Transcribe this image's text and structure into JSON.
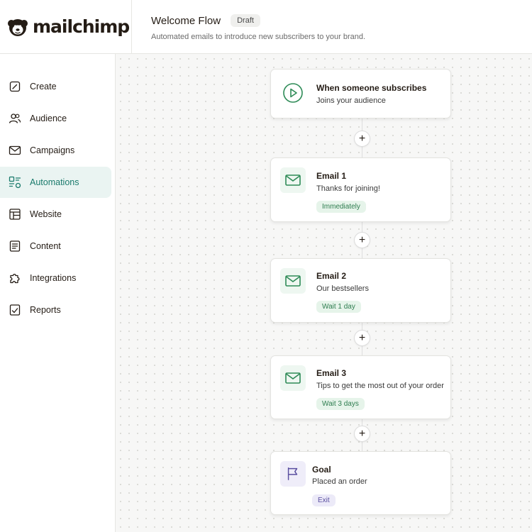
{
  "brand": {
    "name": "mailchimp",
    "accent": "#1a7a6c",
    "mail_green": "#2e8b57",
    "goal_purple": "#5a4fa0"
  },
  "header": {
    "title": "Welcome Flow",
    "status": "Draft",
    "subtitle": "Automated emails to introduce new subscribers to your brand."
  },
  "sidebar": {
    "items": [
      {
        "label": "Create",
        "icon": "pencil-square-icon",
        "active": false
      },
      {
        "label": "Audience",
        "icon": "people-icon",
        "active": false
      },
      {
        "label": "Campaigns",
        "icon": "envelope-icon",
        "active": false
      },
      {
        "label": "Automations",
        "icon": "automation-icon",
        "active": true
      },
      {
        "label": "Website",
        "icon": "layout-icon",
        "active": false
      },
      {
        "label": "Content",
        "icon": "document-icon",
        "active": false
      },
      {
        "label": "Integrations",
        "icon": "puzzle-icon",
        "active": false
      },
      {
        "label": "Reports",
        "icon": "report-icon",
        "active": false
      }
    ]
  },
  "flow": {
    "trigger": {
      "title": "When someone subscribes",
      "subtitle": "Joins your audience",
      "icon": "play-circle-icon"
    },
    "add_label": "+",
    "emails": [
      {
        "title": "Email 1",
        "subtitle": "Thanks for joining!",
        "timing": "Immediately",
        "icon": "mail-icon"
      },
      {
        "title": "Email 2",
        "subtitle": "Our bestsellers",
        "timing": "Wait 1 day",
        "icon": "mail-icon"
      },
      {
        "title": "Email 3",
        "subtitle": "Tips to get the most out of your order",
        "timing": "Wait 3 days",
        "icon": "mail-icon"
      }
    ],
    "goal": {
      "title": "Goal",
      "subtitle": "Placed an order",
      "action": "Exit",
      "icon": "flag-icon"
    }
  }
}
